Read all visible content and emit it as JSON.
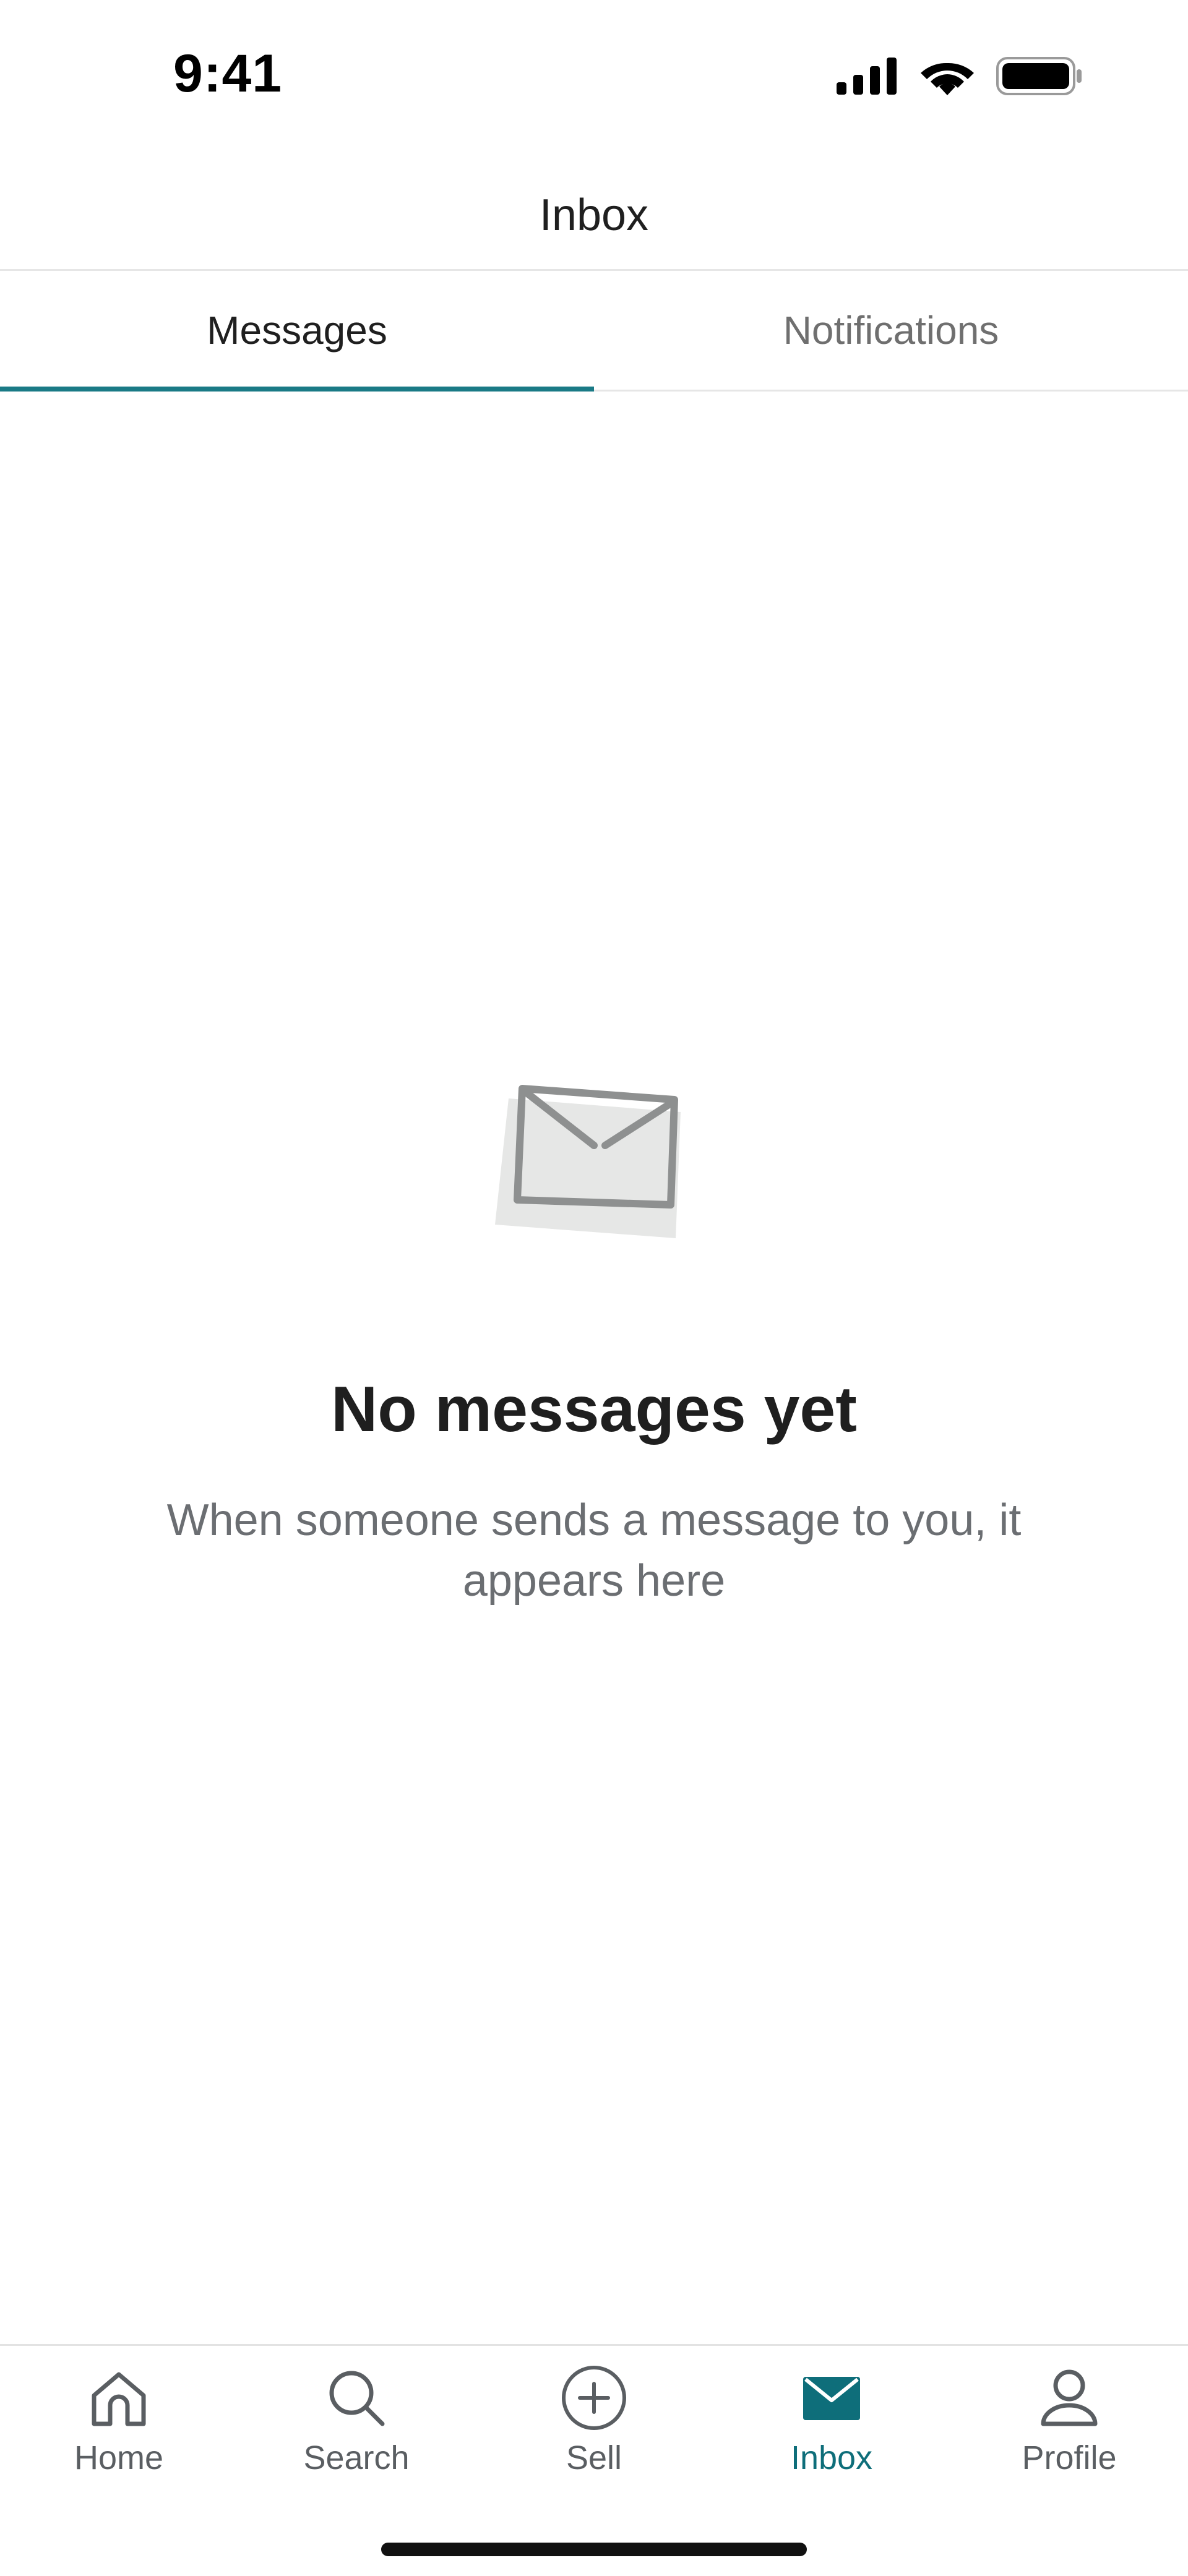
{
  "status_bar": {
    "time": "9:41",
    "icons": [
      "signal-icon",
      "wifi-icon",
      "battery-icon"
    ]
  },
  "header": {
    "title": "Inbox"
  },
  "tabs": [
    {
      "label": "Messages",
      "active": true
    },
    {
      "label": "Notifications",
      "active": false
    }
  ],
  "empty_state": {
    "icon": "envelope-icon",
    "title": "No messages yet",
    "subtitle": "When someone sends a message to you, it appears here"
  },
  "bottom_nav": {
    "items": [
      {
        "label": "Home",
        "icon": "home-icon",
        "active": false
      },
      {
        "label": "Search",
        "icon": "search-icon",
        "active": false
      },
      {
        "label": "Sell",
        "icon": "plus-circle-icon",
        "active": false
      },
      {
        "label": "Inbox",
        "icon": "mail-icon",
        "active": true
      },
      {
        "label": "Profile",
        "icon": "person-icon",
        "active": false
      }
    ]
  },
  "colors": {
    "accent": "#1a7a86",
    "active_nav": "#0e6e7a",
    "muted_text": "#6b6e72"
  }
}
